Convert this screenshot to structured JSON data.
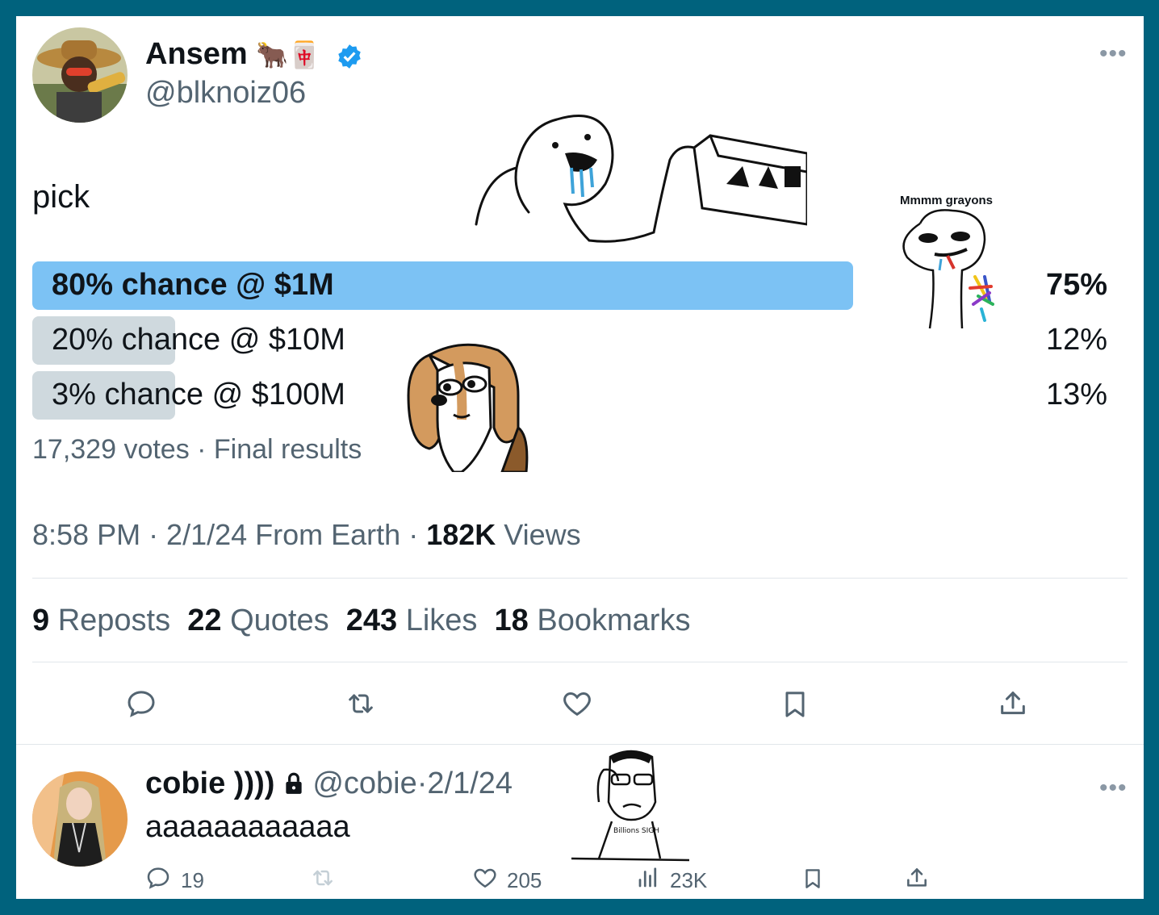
{
  "tweet": {
    "author_name": "Ansem",
    "author_emoji": "🐂🀄",
    "author_handle": "@blknoiz06",
    "text": "pick",
    "poll": {
      "options": [
        {
          "label": "80% chance @ $1M",
          "percent": "75%",
          "fraction": 0.75,
          "winner": true
        },
        {
          "label": "20% chance @ $10M",
          "percent": "12%",
          "fraction": 0.12,
          "winner": false
        },
        {
          "label": "3% chance @ $100M",
          "percent": "13%",
          "fraction": 0.13,
          "winner": false
        }
      ],
      "footer": "17,329 votes · Final results"
    },
    "meta": {
      "time_date": "8:58 PM · 2/1/24 From Earth · ",
      "views_count": "182K",
      "views_label": " Views"
    },
    "stats": [
      {
        "count": "9",
        "label": "Reposts"
      },
      {
        "count": "22",
        "label": "Quotes"
      },
      {
        "count": "243",
        "label": "Likes"
      },
      {
        "count": "18",
        "label": "Bookmarks"
      }
    ],
    "sticker_caption": "Mmmm grayons",
    "sign_text": "Billions SIGH"
  },
  "reply": {
    "author_name": "cobie ))))",
    "author_handle": "@cobie",
    "date": "·2/1/24",
    "text": "aaaaaaaaaaaa",
    "replies": "19",
    "likes": "205",
    "views": "23K"
  },
  "colors": {
    "frame": "#00627d",
    "winner_bar": "#7cc2f4",
    "loser_bar": "#cfd9de",
    "verified": "#1d9bf0"
  },
  "icons": [
    "more-icon",
    "verified-badge-icon",
    "lock-icon",
    "reply-icon",
    "repost-icon",
    "like-icon",
    "bookmark-icon",
    "share-icon",
    "views-icon"
  ]
}
